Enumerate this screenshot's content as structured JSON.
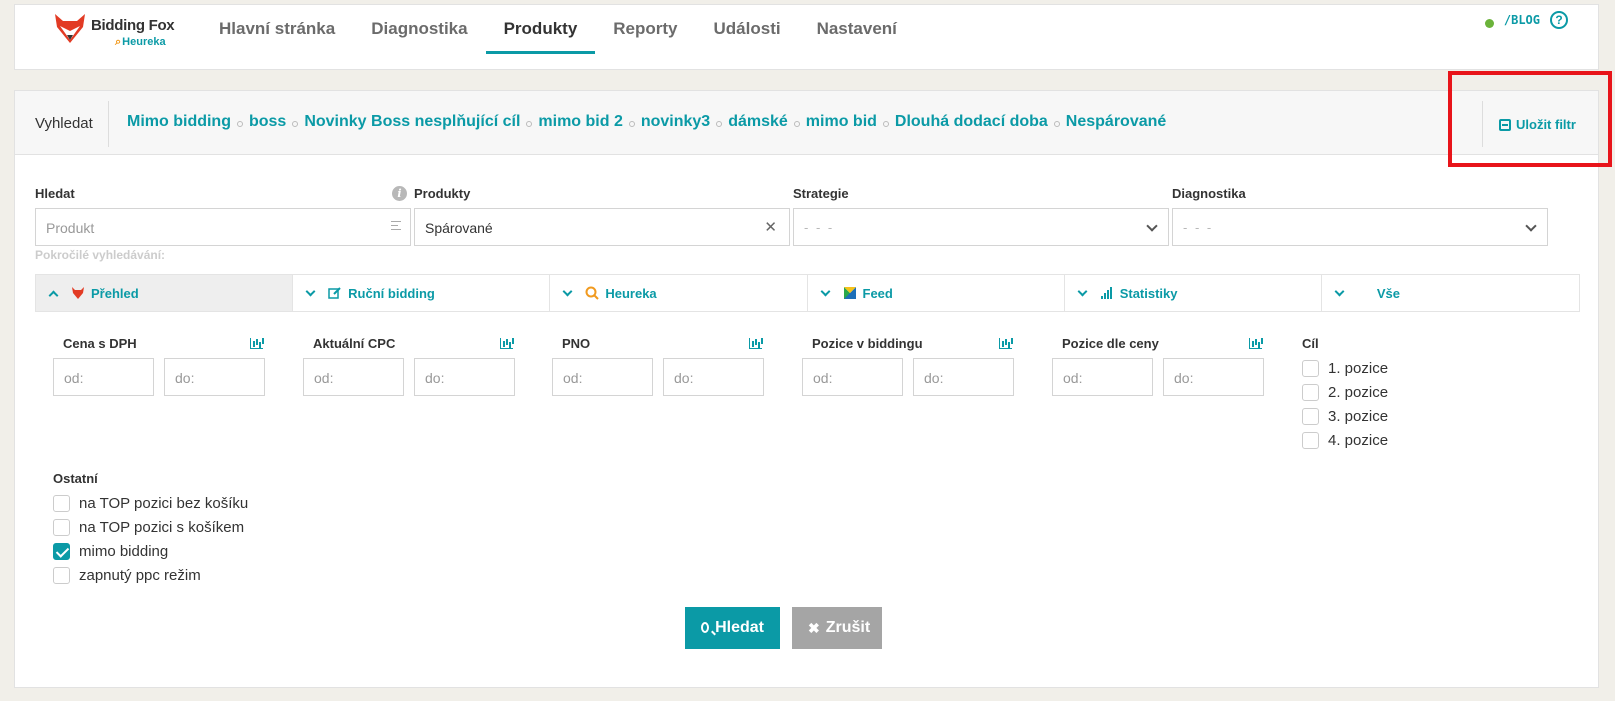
{
  "brand": {
    "name": "Bidding Fox",
    "sub": "Heureka"
  },
  "nav": {
    "items": [
      {
        "label": "Hlavní stránka",
        "active": false
      },
      {
        "label": "Diagnostika",
        "active": false
      },
      {
        "label": "Produkty",
        "active": true
      },
      {
        "label": "Reporty",
        "active": false
      },
      {
        "label": "Události",
        "active": false
      },
      {
        "label": "Nastavení",
        "active": false
      }
    ],
    "blog": "/BLOG",
    "help": "?"
  },
  "search": {
    "label": "Vyhledat",
    "filters": [
      "Mimo bidding",
      "boss",
      "Novinky Boss nesplňující cíl",
      "mimo bid 2",
      "novinky3",
      "dámské",
      "mimo bid",
      "Dlouhá dodací doba",
      "Nespárované"
    ],
    "save_filter": "Uložit filtr"
  },
  "fields": {
    "hledat": {
      "label": "Hledat",
      "placeholder": "Produkt"
    },
    "produkty": {
      "label": "Produkty",
      "value": "Spárované"
    },
    "strategie": {
      "label": "Strategie",
      "value": "- - -"
    },
    "diagnostika": {
      "label": "Diagnostika",
      "value": "- - -"
    }
  },
  "advanced_label": "Pokročilé vyhledávání:",
  "tabs": [
    {
      "label": "Přehled",
      "icon": "fox-icon",
      "active": true
    },
    {
      "label": "Ruční bidding",
      "icon": "edit-icon",
      "active": false
    },
    {
      "label": "Heureka",
      "icon": "heureka-icon",
      "active": false
    },
    {
      "label": "Feed",
      "icon": "feed-icon",
      "active": false
    },
    {
      "label": "Statistiky",
      "icon": "signal-icon",
      "active": false
    },
    {
      "label": "Vše",
      "icon": "",
      "active": false
    }
  ],
  "ranges": [
    {
      "label": "Cena s DPH",
      "from": "od:",
      "to": "do:"
    },
    {
      "label": "Aktuální CPC",
      "from": "od:",
      "to": "do:"
    },
    {
      "label": "PNO",
      "from": "od:",
      "to": "do:"
    },
    {
      "label": "Pozice v biddingu",
      "from": "od:",
      "to": "do:"
    },
    {
      "label": "Pozice dle ceny",
      "from": "od:",
      "to": "do:"
    }
  ],
  "cil": {
    "label": "Cíl",
    "options": [
      {
        "label": "1. pozice",
        "checked": false
      },
      {
        "label": "2. pozice",
        "checked": false
      },
      {
        "label": "3. pozice",
        "checked": false
      },
      {
        "label": "4. pozice",
        "checked": false
      }
    ]
  },
  "ostatni": {
    "label": "Ostatní",
    "options": [
      {
        "label": "na TOP pozici bez košíku",
        "checked": false
      },
      {
        "label": "na TOP pozici s košíkem",
        "checked": false
      },
      {
        "label": "mimo bidding",
        "checked": true
      },
      {
        "label": "zapnutý ppc režim",
        "checked": false
      }
    ]
  },
  "buttons": {
    "search": "Hledat",
    "cancel": "Zrušit"
  },
  "colors": {
    "accent": "#0b9aa6",
    "highlight": "#e8141a",
    "fox": "#e23b24",
    "heureka": "#f19a1f"
  }
}
